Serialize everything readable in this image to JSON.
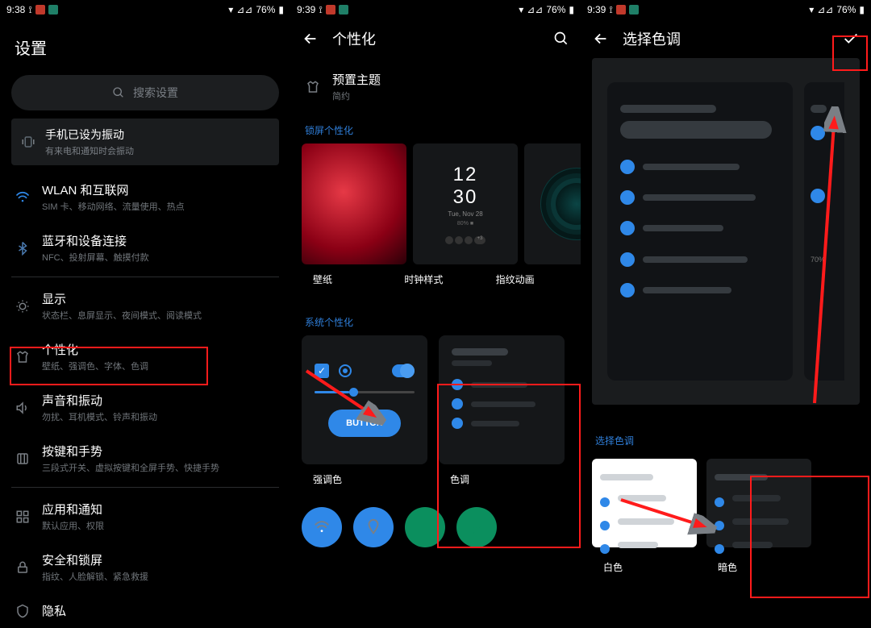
{
  "status": {
    "time1": "9:38",
    "time2": "9:39",
    "time3": "9:39",
    "battery": "76%"
  },
  "screen1": {
    "title": "设置",
    "search_placeholder": "搜索设置",
    "banner": {
      "title": "手机已设为振动",
      "sub": "有来电和通知时会振动"
    },
    "items": [
      {
        "icon": "wifi",
        "title": "WLAN 和互联网",
        "sub": "SIM 卡、移动网络、流量使用、热点"
      },
      {
        "icon": "bt",
        "title": "蓝牙和设备连接",
        "sub": "NFC、投射屏幕、触摸付款"
      },
      {
        "icon": "display",
        "title": "显示",
        "sub": "状态栏、息屏显示、夜间模式、阅读模式"
      },
      {
        "icon": "shirt",
        "title": "个性化",
        "sub": "壁纸、强调色、字体、色调"
      },
      {
        "icon": "sound",
        "title": "声音和振动",
        "sub": "勿扰、耳机模式、铃声和振动"
      },
      {
        "icon": "gesture",
        "title": "按键和手势",
        "sub": "三段式开关、虚拟按键和全屏手势、快捷手势"
      },
      {
        "icon": "apps",
        "title": "应用和通知",
        "sub": "默认应用、权限"
      },
      {
        "icon": "lock",
        "title": "安全和锁屏",
        "sub": "指纹、人脸解锁、紧急救援"
      },
      {
        "icon": "privacy",
        "title": "隐私",
        "sub": ""
      }
    ]
  },
  "screen2": {
    "title": "个性化",
    "preset_theme_label": "预置主题",
    "preset_theme_value": "简约",
    "sec_lock": "锁屏个性化",
    "cards": [
      "壁纸",
      "时钟样式",
      "指纹动画"
    ],
    "clock": {
      "line1": "12",
      "line2": "30",
      "line3": "Tue, Nov 28"
    },
    "sec_sys": "系统个性化",
    "button_label": "BUTTON",
    "accent_label": "强调色",
    "tone_label": "色调"
  },
  "screen3": {
    "title": "选择色调",
    "choose_tone": "选择色调",
    "tone_options": [
      "白色",
      "暗色"
    ]
  }
}
